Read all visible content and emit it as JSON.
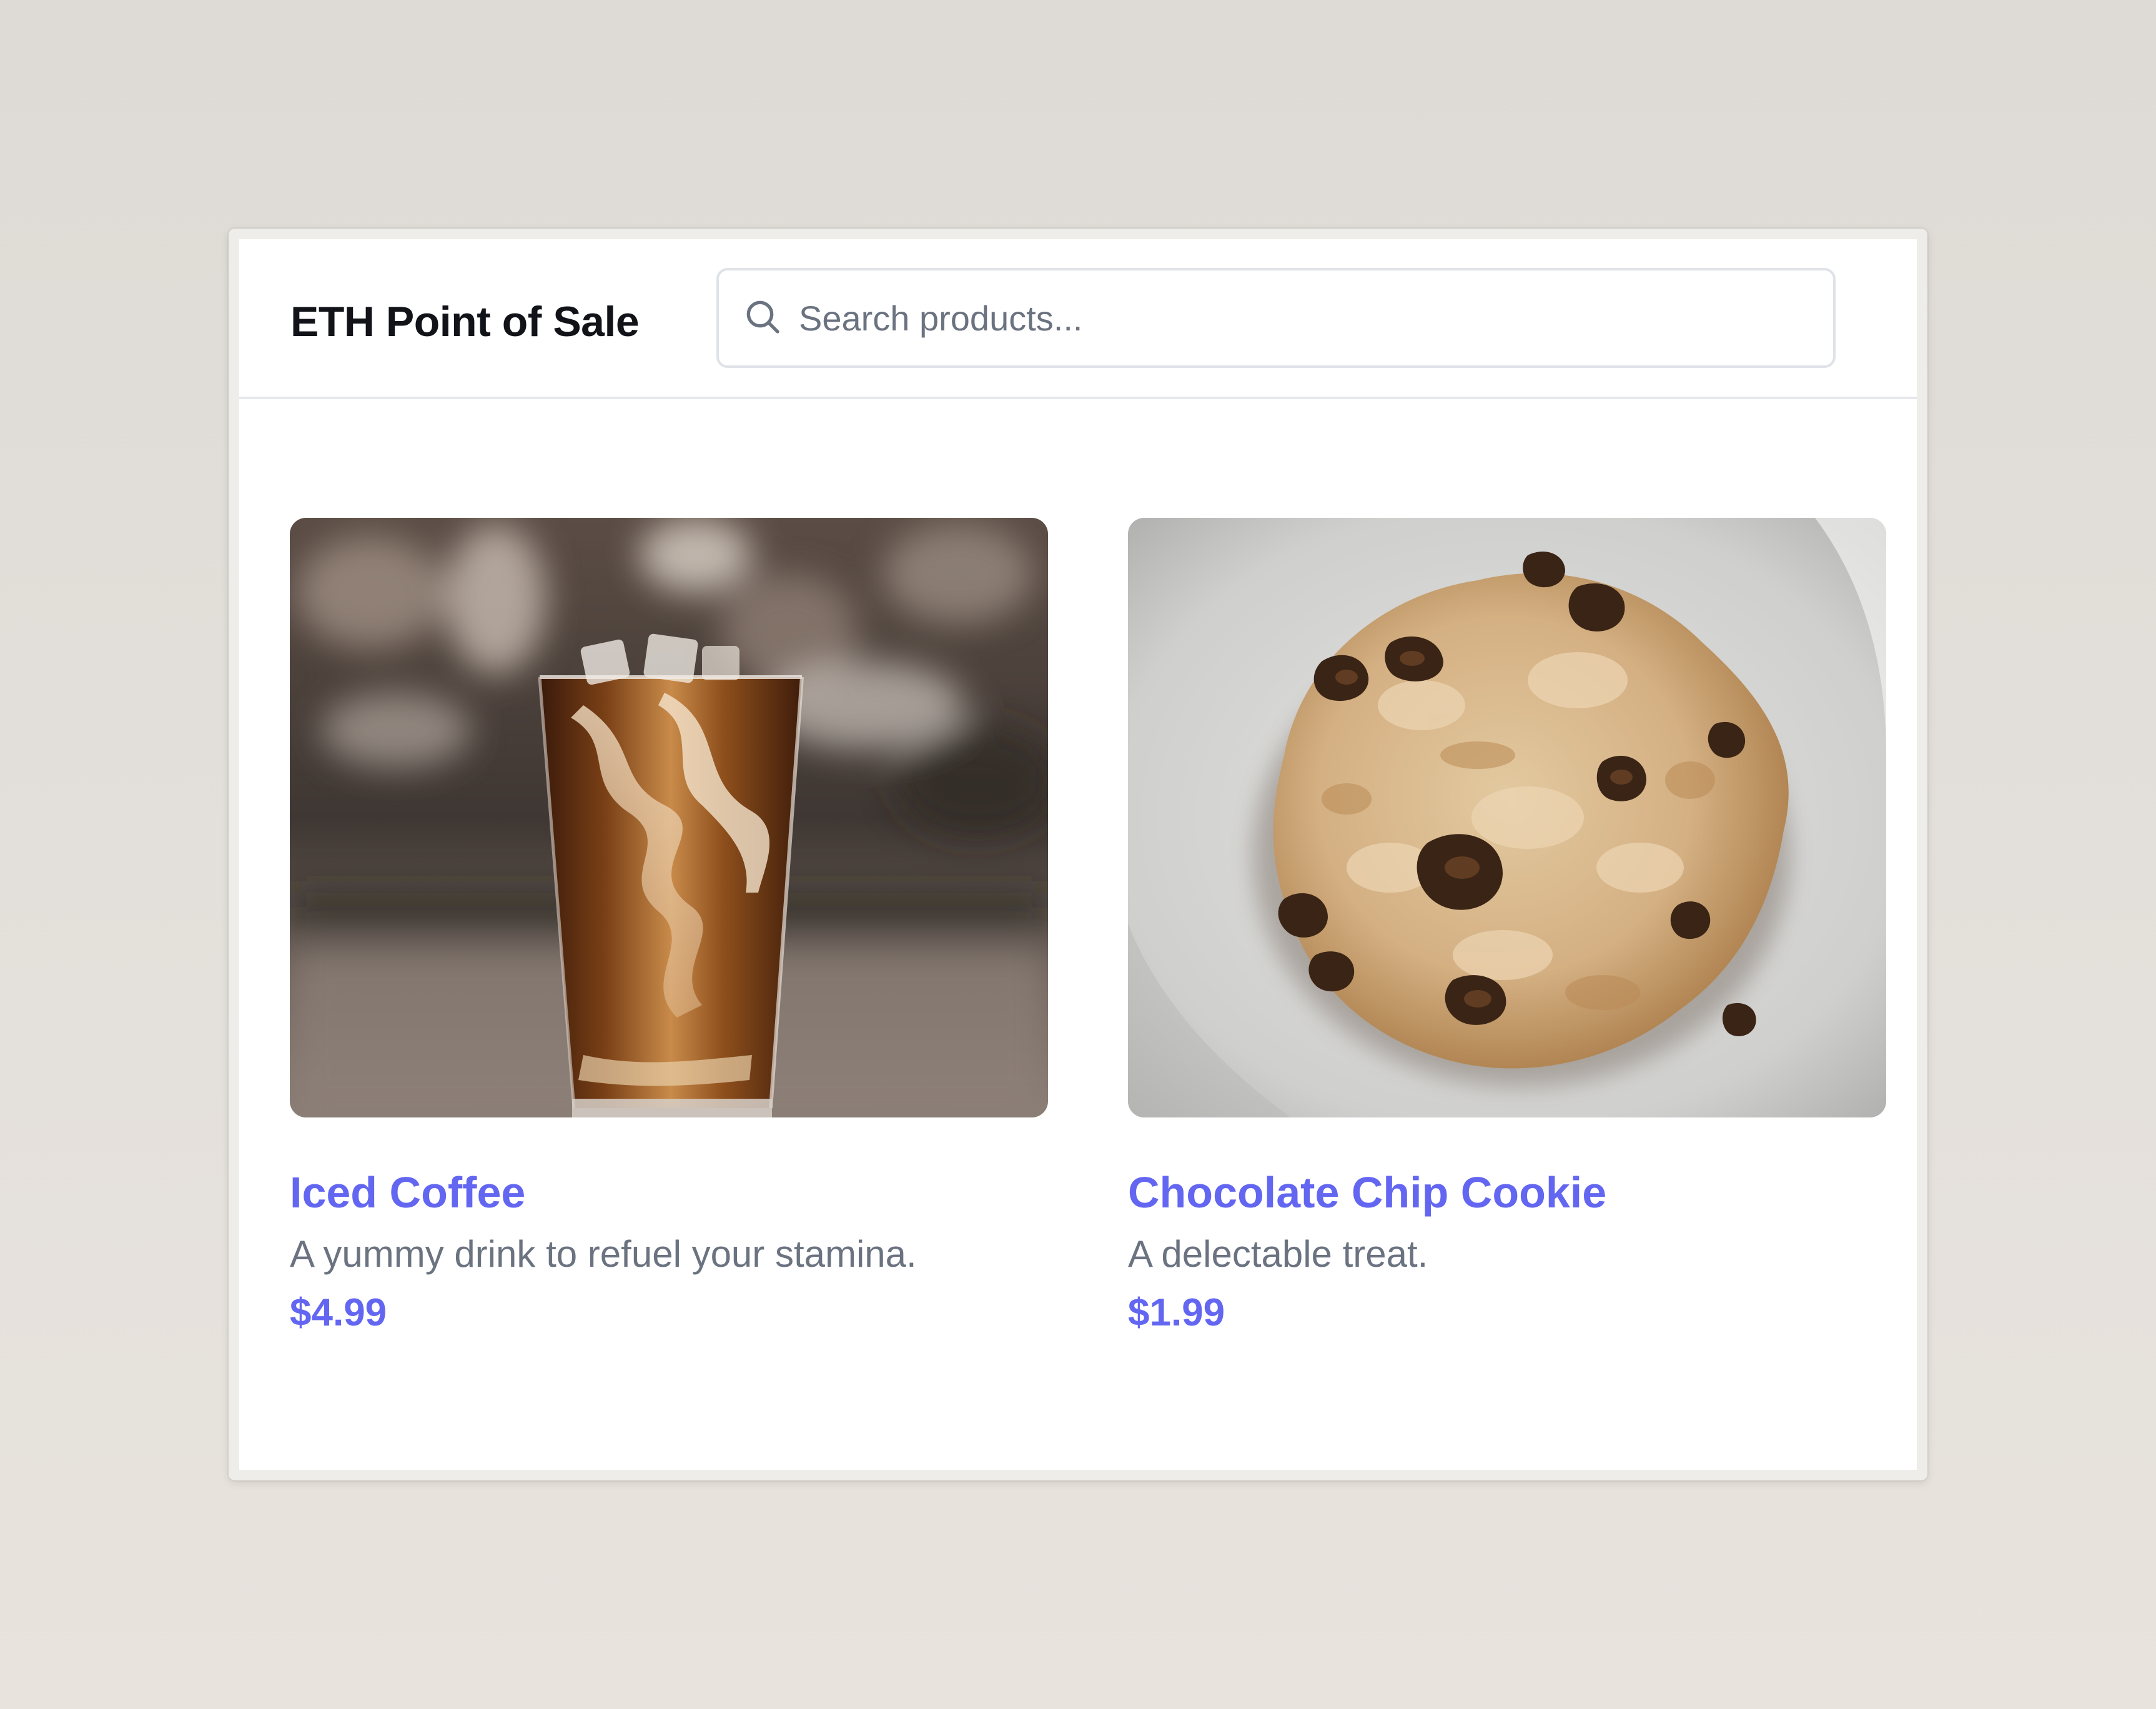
{
  "app": {
    "title": "ETH Point of Sale"
  },
  "search": {
    "placeholder": "Search products...",
    "value": "",
    "icon": "search-icon"
  },
  "products": [
    {
      "name": "Iced Coffee",
      "description": "A yummy drink to refuel your stamina.",
      "price": "$4.99"
    },
    {
      "name": "Chocolate Chip Cookie",
      "description": "A delectable treat.",
      "price": "$1.99"
    }
  ],
  "colors": {
    "accent": "#6366f1",
    "text_primary": "#111318",
    "text_secondary": "#6b7280",
    "border": "#e5e7eb",
    "page_background": "#e0dbd5"
  }
}
